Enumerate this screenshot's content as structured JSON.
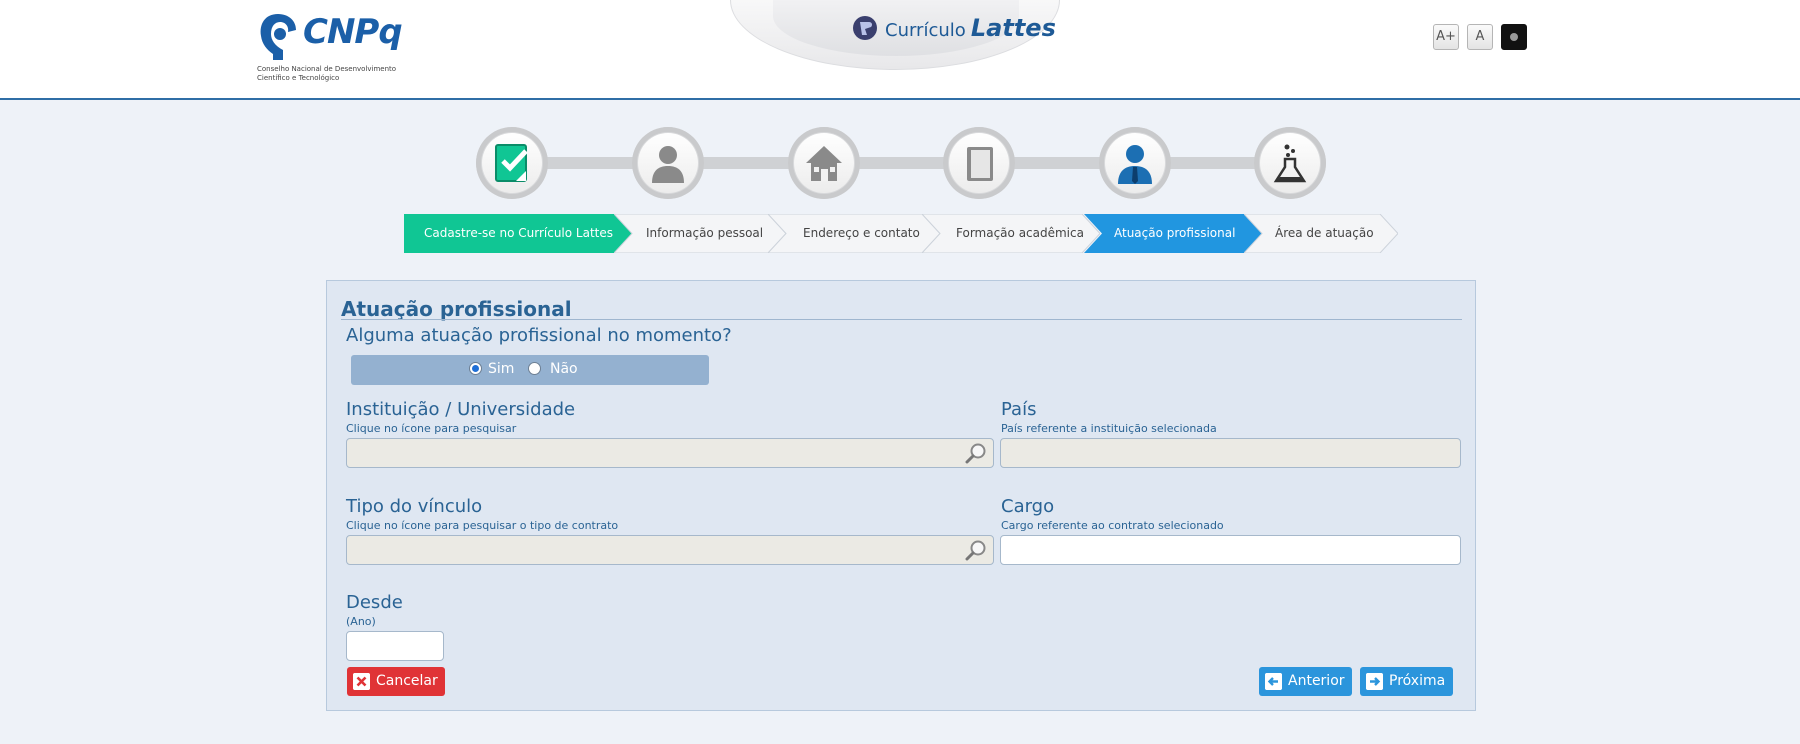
{
  "header": {
    "logo_text": "CNPq",
    "logo_subtitle_line1": "Conselho Nacional de Desenvolvimento",
    "logo_subtitle_line2": "Científico e Tecnológico",
    "app_title_small": "Currículo",
    "app_title_big": "Lattes",
    "font_increase_label": "A+",
    "font_default_label": "A"
  },
  "steps": [
    {
      "label": "Cadastre-se no Currículo Lattes",
      "state": "done",
      "icon": "form-check-icon"
    },
    {
      "label": "Informação pessoal",
      "state": "pending",
      "icon": "person-icon"
    },
    {
      "label": "Endereço e contato",
      "state": "pending",
      "icon": "house-icon"
    },
    {
      "label": "Formação acadêmica",
      "state": "pending",
      "icon": "book-icon"
    },
    {
      "label": "Atuação profissional",
      "state": "active",
      "icon": "professional-icon"
    },
    {
      "label": "Área de atuação",
      "state": "pending",
      "icon": "flask-icon"
    }
  ],
  "form": {
    "title": "Atuação profissional",
    "question": "Alguma atuação profissional no momento?",
    "radio_yes": "Sim",
    "radio_no": "Não",
    "selected": "Sim",
    "institution_label": "Instituição / Universidade",
    "institution_hint": "Clique no ícone para pesquisar",
    "institution_value": "",
    "country_label": "País",
    "country_hint": "País referente a instituição selecionada",
    "country_value": "",
    "bond_label": "Tipo do vínculo",
    "bond_hint": "Clique no ícone para pesquisar o tipo de contrato",
    "bond_value": "",
    "role_label": "Cargo",
    "role_hint": "Cargo referente ao contrato selecionado",
    "role_value": "",
    "since_label": "Desde",
    "since_hint": "(Ano)",
    "since_value": ""
  },
  "buttons": {
    "cancel": "Cancelar",
    "previous": "Anterior",
    "next": "Próxima"
  },
  "colors": {
    "done_step": "#10c694",
    "active_step": "#2196e0",
    "cancel": "#e03336",
    "nav_button": "#2b95dc"
  }
}
